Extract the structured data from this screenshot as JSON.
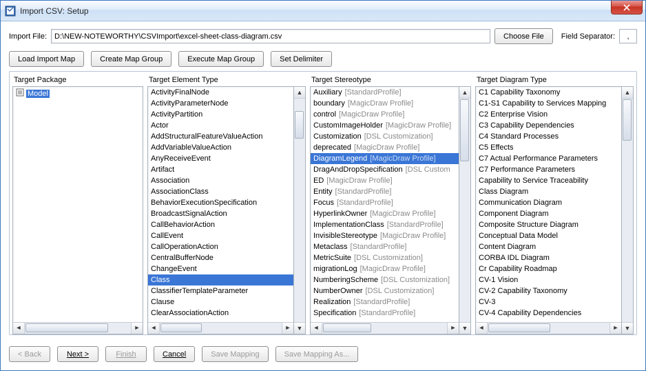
{
  "window": {
    "title": "Import CSV: Setup"
  },
  "topRow": {
    "importFileLabel": "Import File:",
    "importFileValue": "D:\\NEW-NOTEWORTHY\\CSVImport\\excel-sheet-class-diagram.csv",
    "chooseFile": "Choose File",
    "fieldSeparatorLabel": "Field Separator:",
    "fieldSeparatorValue": ","
  },
  "toolbar": {
    "loadImportMap": "Load Import Map",
    "createMapGroup": "Create Map Group",
    "executeMapGroup": "Execute Map Group",
    "setDelimiter": "Set Delimiter"
  },
  "panels": {
    "targetPackage": {
      "header": "Target Package",
      "root": "Model"
    },
    "elementType": {
      "header": "Target Element Type",
      "items": [
        "ActivityFinalNode",
        "ActivityParameterNode",
        "ActivityPartition",
        "Actor",
        "AddStructuralFeatureValueAction",
        "AddVariableValueAction",
        "AnyReceiveEvent",
        "Artifact",
        "Association",
        "AssociationClass",
        "BehaviorExecutionSpecification",
        "BroadcastSignalAction",
        "CallBehaviorAction",
        "CallEvent",
        "CallOperationAction",
        "CentralBufferNode",
        "ChangeEvent",
        "Class",
        "ClassifierTemplateParameter",
        "Clause",
        "ClearAssociationAction"
      ],
      "selectedIndex": 17
    },
    "stereotype": {
      "header": "Target Stereotype",
      "items": [
        {
          "name": "Auxiliary",
          "profile": "[StandardProfile]"
        },
        {
          "name": "boundary",
          "profile": "[MagicDraw Profile]"
        },
        {
          "name": "control",
          "profile": "[MagicDraw Profile]"
        },
        {
          "name": "CustomImageHolder",
          "profile": "[MagicDraw Profile]"
        },
        {
          "name": "Customization",
          "profile": "[DSL Customization]"
        },
        {
          "name": "deprecated",
          "profile": "[MagicDraw Profile]"
        },
        {
          "name": "DiagramLegend",
          "profile": "[MagicDraw Profile]"
        },
        {
          "name": "DragAndDropSpecification",
          "profile": "[DSL Custom"
        },
        {
          "name": "ED",
          "profile": "[MagicDraw Profile]"
        },
        {
          "name": "Entity",
          "profile": "[StandardProfile]"
        },
        {
          "name": "Focus",
          "profile": "[StandardProfile]"
        },
        {
          "name": "HyperlinkOwner",
          "profile": "[MagicDraw Profile]"
        },
        {
          "name": "ImplementationClass",
          "profile": "[StandardProfile]"
        },
        {
          "name": "InvisibleStereotype",
          "profile": "[MagicDraw Profile]"
        },
        {
          "name": "Metaclass",
          "profile": "[StandardProfile]"
        },
        {
          "name": "MetricSuite",
          "profile": "[DSL Customization]"
        },
        {
          "name": "migrationLog",
          "profile": "[MagicDraw Profile]"
        },
        {
          "name": "NumberingScheme",
          "profile": "[DSL Customization]"
        },
        {
          "name": "NumberOwner",
          "profile": "[DSL Customization]"
        },
        {
          "name": "Realization",
          "profile": "[StandardProfile]"
        },
        {
          "name": "Specification",
          "profile": "[StandardProfile]"
        }
      ],
      "selectedIndex": 6
    },
    "diagramType": {
      "header": "Target Diagram Type",
      "items": [
        "C1 Capability Taxonomy",
        "C1-S1 Capability to Services Mapping",
        "C2 Enterprise Vision",
        "C3 Capability Dependencies",
        "C4 Standard Processes",
        "C5 Effects",
        "C7 Actual Performance Parameters",
        "C7 Performance Parameters",
        "Capability to Service Traceability",
        "Class Diagram",
        "Communication Diagram",
        "Component Diagram",
        "Composite Structure Diagram",
        "Conceptual Data Model",
        "Content Diagram",
        "CORBA IDL Diagram",
        "Cr Capability Roadmap",
        "CV-1 Vision",
        "CV-2 Capability Taxonomy",
        "CV-3",
        "CV-4 Capability Dependencies"
      ]
    }
  },
  "footer": {
    "back": "< Back",
    "next": "Next >",
    "finish": "Finish",
    "cancel": "Cancel",
    "saveMapping": "Save Mapping",
    "saveMappingAs": "Save Mapping As..."
  }
}
